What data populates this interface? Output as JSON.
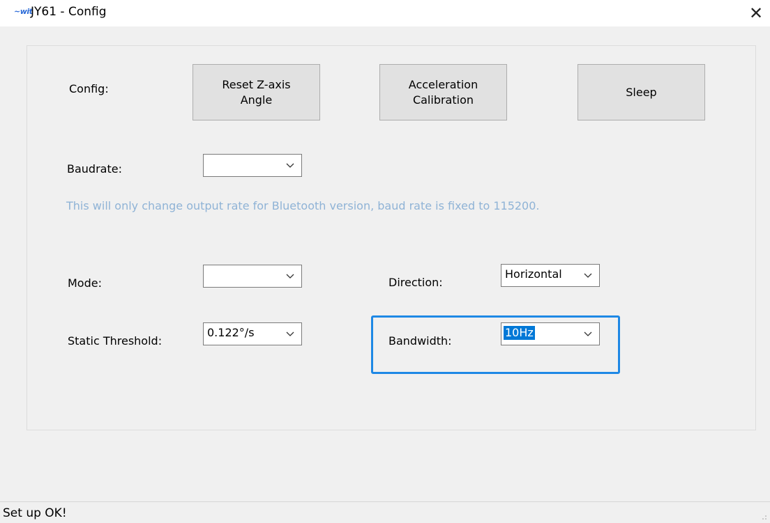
{
  "window": {
    "icon_text": "~wit",
    "title": "JY61 - Config",
    "close_glyph": "✕"
  },
  "config": {
    "label": "Config:",
    "reset_z_axis": "Reset Z-axis\nAngle",
    "acceleration_calibration": "Acceleration\nCalibration",
    "sleep": "Sleep"
  },
  "baudrate": {
    "label": "Baudrate:",
    "value": "",
    "hint": "This will only change output rate for Bluetooth version, baud rate is fixed to 115200."
  },
  "mode": {
    "label": "Mode:",
    "value": ""
  },
  "direction": {
    "label": "Direction:",
    "value": "Horizontal"
  },
  "static_threshold": {
    "label": "Static Threshold:",
    "value": "0.122°/s"
  },
  "bandwidth": {
    "label": "Bandwidth:",
    "value": "10Hz"
  },
  "status": {
    "text": "Set up OK!"
  },
  "colors": {
    "accent": "#1e88e5",
    "selection": "#0078d7",
    "hint": "#8fb3d6"
  }
}
